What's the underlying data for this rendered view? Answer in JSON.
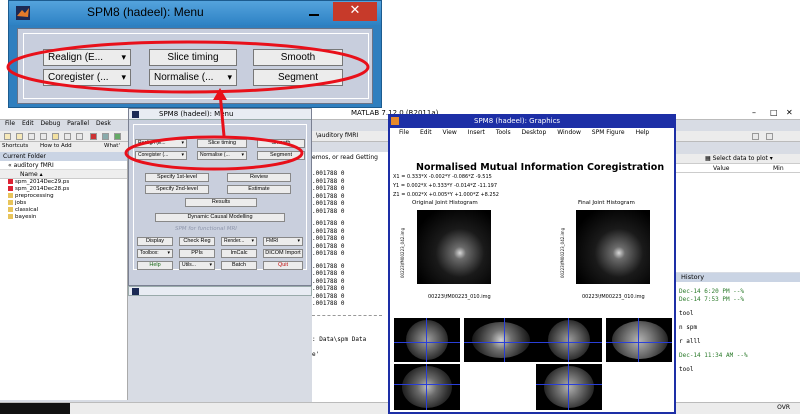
{
  "zoom_menu": {
    "title": "SPM8 (hadeel): Menu",
    "close_label": "✕",
    "row1": {
      "realign": "Realign (E...",
      "slice_timing": "Slice timing",
      "smooth": "Smooth"
    },
    "row2": {
      "coregister": "Coregister (...",
      "normalise": "Normalise (...",
      "segment": "Segment"
    }
  },
  "highlight_color": "#e8101a",
  "matlab": {
    "title": "MATLAB  7.12.0 (R2011a)",
    "menu": [
      "File",
      "Edit",
      "Debug",
      "Parallel",
      "Desk"
    ],
    "shortcuts": [
      "Shortcuts",
      "How to Add",
      "What'"
    ],
    "current_folder": {
      "header": "Current Folder",
      "path": "auditory fMRI",
      "column": "Name",
      "files": [
        {
          "name": "spm_2014Dec29.ps",
          "type": "file"
        },
        {
          "name": "spm_2014Dec28.ps",
          "type": "file"
        },
        {
          "name": "preprocessing",
          "type": "folder"
        },
        {
          "name": "jobs",
          "type": "folder"
        },
        {
          "name": "classical",
          "type": "folder"
        },
        {
          "name": "bayesin",
          "type": "folder"
        }
      ]
    },
    "path_suffix": "\\auditory fMRI",
    "demos_text": "emos, or read Getting",
    "command_lines": [
      ".001788  0",
      ".001788  0",
      ".001788  0",
      ".001788  0",
      ".001788  0",
      ".001788  0",
      ".001788  0",
      ".001788  0",
      ".001788  0",
      ".001788  0",
      ".001788  0",
      ".001788  0",
      ".001788  0",
      ".001788  0",
      ".001788  0",
      ".001788  0",
      ".001788  0"
    ],
    "command_tail": [
      ": Data\\spm Data",
      "e'"
    ],
    "workspace": {
      "select_label": "Select data to plot",
      "value_col": "Value",
      "min_col": "Min"
    },
    "history": {
      "header": "History",
      "lines": [
        "Dec-14  6:20 PM --%",
        "Dec-14  7:53 PM --%",
        "tool",
        "n spm",
        "r alll",
        "Dec-14 11:34 AM --%",
        "tool"
      ]
    },
    "status_right": "OVR"
  },
  "spm_small": {
    "title": "SPM8 (hadeel): Menu",
    "row1": [
      "Realign (E...",
      "Slice timing",
      "Smooth"
    ],
    "row2": [
      "Coregister (...",
      "Normalise (...",
      "Segment"
    ],
    "specify1": "Specify 1st-level",
    "review": "Review",
    "specify2": "Specify 2nd-level",
    "estimate": "Estimate",
    "results": "Results",
    "dcm": "Dynamic Causal Modelling",
    "watermark": "SPM for functional MRI",
    "tools": [
      [
        "Display",
        "Check Reg",
        "Render...",
        "FMRI"
      ],
      [
        "Toolbox:",
        "PPIs",
        "ImCalc",
        "DICOM Import"
      ],
      [
        "Help",
        "Utils...",
        "Batch",
        "Quit"
      ]
    ]
  },
  "graphics": {
    "title": "SPM8 (hadeel): Graphics",
    "menu": [
      "File",
      "Edit",
      "View",
      "Insert",
      "Tools",
      "Desktop",
      "Window",
      "SPM Figure",
      "Help"
    ],
    "heading": "Normalised Mutual Information Coregistration",
    "x1": "X1 = 0.333*X -0.002*Y -0.086*Z -9.515",
    "y1": "Y1 = 0.002*X +0.333*Y -0.014*Z -11.197",
    "z1": "Z1 = 0.002*X +0.005*Y +1.000*Z +8.252",
    "hist1_title": "Original Joint Histogram",
    "hist2_title": "Final Joint Histogram",
    "hist_ylabel": "00223\\fM00223_042.img",
    "hist1_xlabel": "00223\\fM00223_010.img",
    "hist2_xlabel": "00223\\fM00223_010.img"
  }
}
